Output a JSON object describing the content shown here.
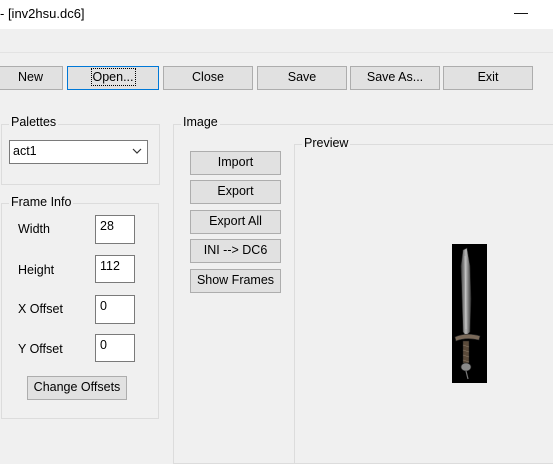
{
  "window": {
    "title": "- [inv2hsu.dc6]",
    "minimize_glyph": "—"
  },
  "toolbar": {
    "new_label": "New",
    "open_label": "Open...",
    "close_label": "Close",
    "save_label": "Save",
    "save_as_label": "Save As...",
    "exit_label": "Exit"
  },
  "palettes": {
    "legend": "Palettes",
    "selected": "act1"
  },
  "frame_info": {
    "legend": "Frame Info",
    "width_label": "Width",
    "width_value": "28",
    "height_label": "Height",
    "height_value": "112",
    "x_offset_label": "X Offset",
    "x_offset_value": "0",
    "y_offset_label": "Y Offset",
    "y_offset_value": "0",
    "change_offsets_label": "Change Offsets"
  },
  "image": {
    "legend": "Image",
    "import_label": "Import",
    "export_label": "Export",
    "export_all_label": "Export All",
    "ini_dc6_label": "INI --> DC6",
    "show_frames_label": "Show Frames"
  },
  "preview": {
    "legend": "Preview",
    "sprite_icon": "sword-icon"
  },
  "colors": {
    "focus_border": "#0078d7",
    "button_face": "#e1e1e1",
    "window_bg": "#f0f0f0"
  }
}
